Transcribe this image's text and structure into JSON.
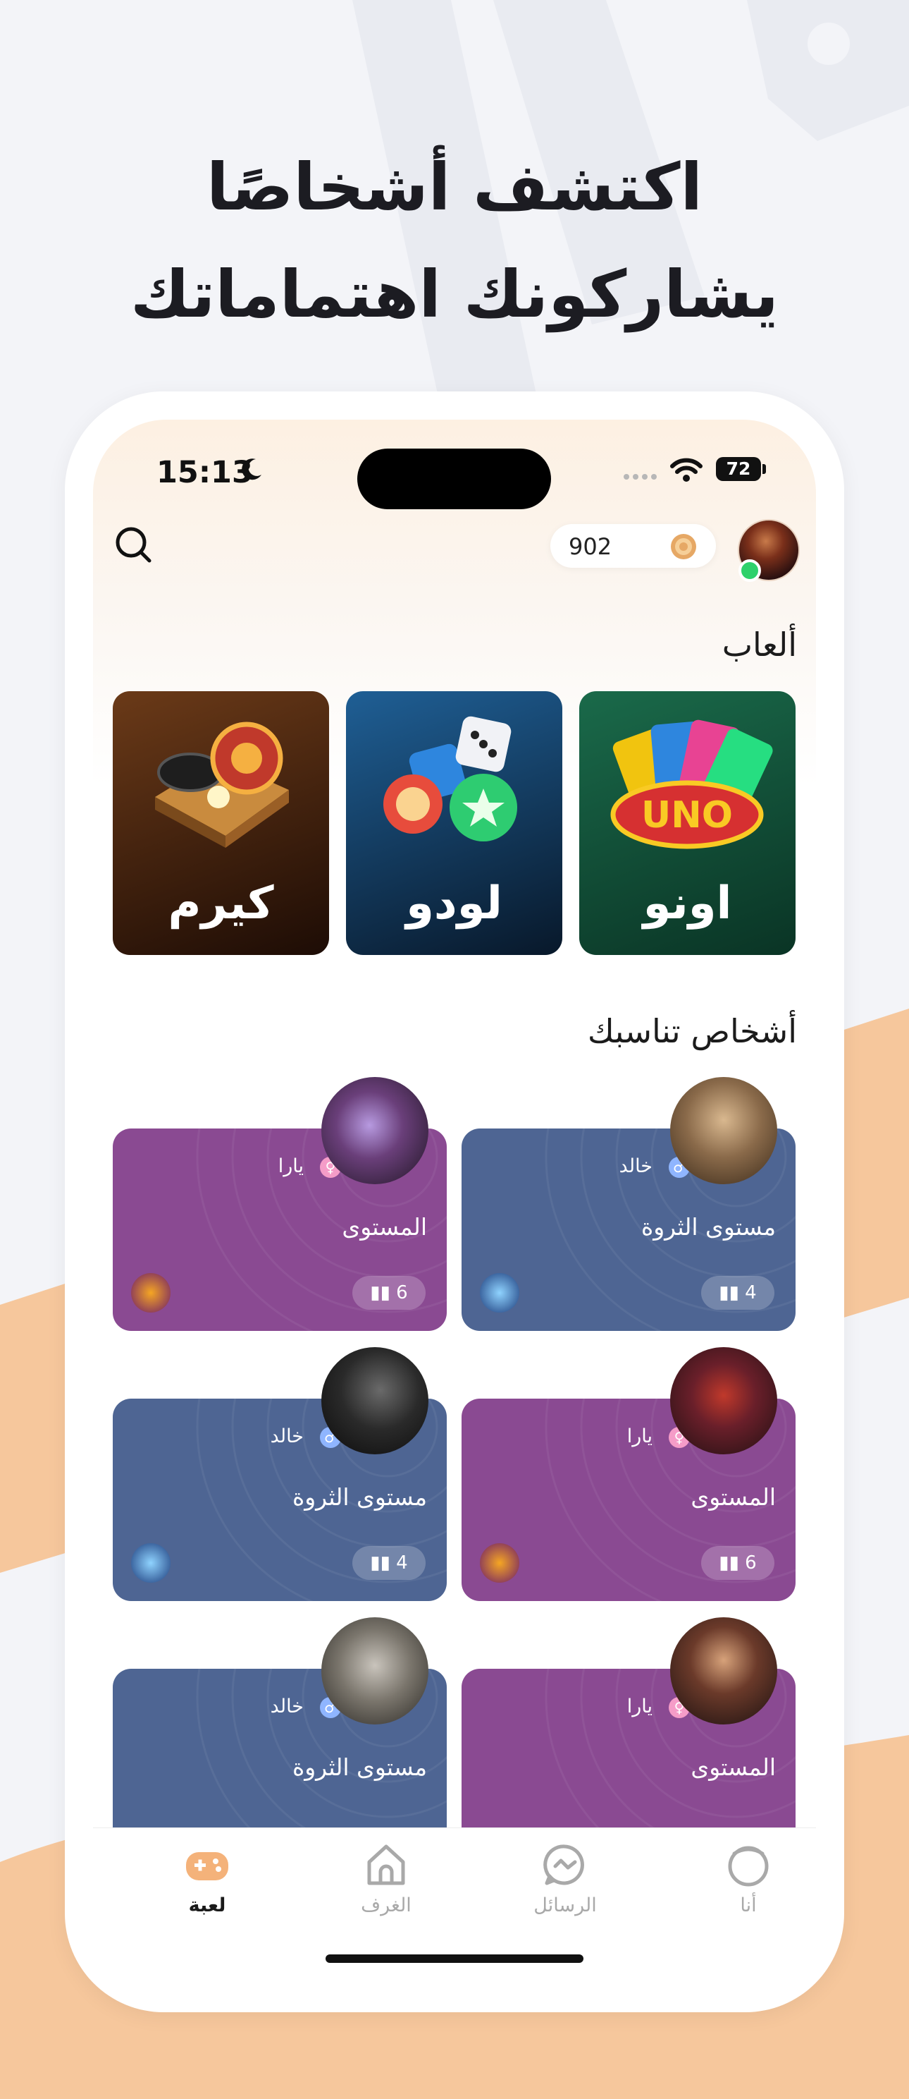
{
  "headline": {
    "line1": "اكتشف أشخاصًا",
    "line2": "يشاركونك اهتماماتك"
  },
  "status_bar": {
    "time": "15:13",
    "battery": "72"
  },
  "header": {
    "coins": "902",
    "search_icon": "search-icon",
    "coin_icon": "gold-coin-icon"
  },
  "games": {
    "title": "ألعاب",
    "items": [
      {
        "label": "اونو",
        "color": "#0d4a33"
      },
      {
        "label": "لودو",
        "color": "#12406a"
      },
      {
        "label": "كيرم",
        "color": "#5a2f12"
      }
    ]
  },
  "people": {
    "title": "أشخاص تناسبك",
    "cards": [
      {
        "name": "خالد",
        "gender": "male",
        "level": "مستوى الثروة",
        "count": "4",
        "color": "#4e6593",
        "game_icon": "ludo-icon"
      },
      {
        "name": "يارا",
        "gender": "female",
        "level": "المستوى",
        "count": "6",
        "color": "#8a4a92",
        "game_icon": "uno-icon"
      },
      {
        "name": "يارا",
        "gender": "female",
        "level": "المستوى",
        "count": "6",
        "color": "#8a4a92",
        "game_icon": "uno-icon"
      },
      {
        "name": "خالد",
        "gender": "male",
        "level": "مستوى الثروة",
        "count": "4",
        "color": "#4e6593",
        "game_icon": "ludo-icon"
      },
      {
        "name": "يارا",
        "gender": "female",
        "level": "المستوى",
        "count": "",
        "color": "#8a4a92",
        "game_icon": "uno-icon"
      },
      {
        "name": "خالد",
        "gender": "male",
        "level": "مستوى الثروة",
        "count": "",
        "color": "#4e6593",
        "game_icon": "ludo-icon"
      }
    ]
  },
  "tabbar": {
    "tabs": [
      {
        "label": "أنا",
        "icon": "profile-icon"
      },
      {
        "label": "الرسائل",
        "icon": "messages-icon"
      },
      {
        "label": "الغرف",
        "icon": "home-icon"
      },
      {
        "label": "لعبة",
        "icon": "gamepad-icon",
        "active": true
      }
    ]
  },
  "colors": {
    "accent_orange": "#f4b27a",
    "background": "#f3f4f8"
  }
}
